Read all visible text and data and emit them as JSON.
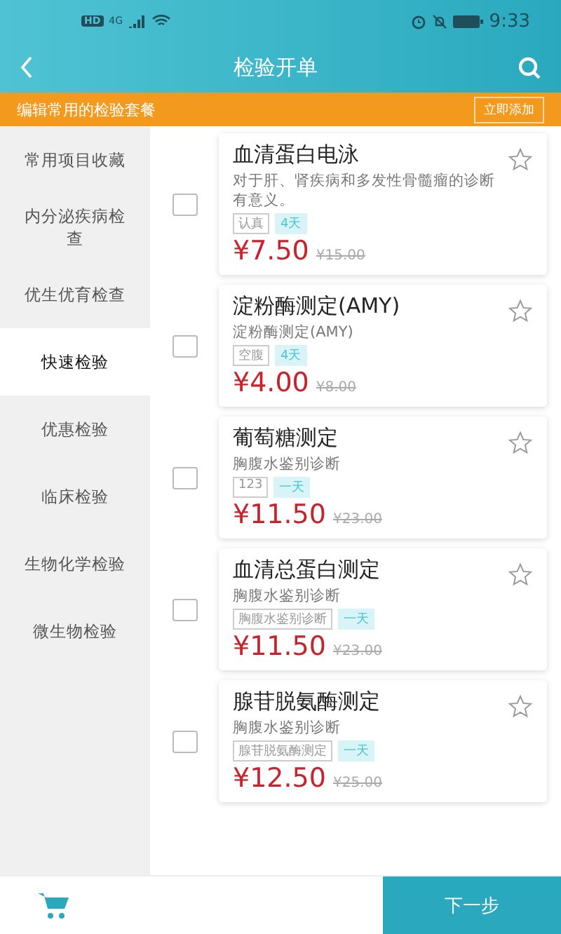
{
  "status_bar": {
    "network_badge": "HD",
    "network_type": "4G",
    "time": "9:33"
  },
  "header": {
    "title": "检验开单"
  },
  "banner": {
    "text": "编辑常用的检验套餐",
    "button": "立即添加"
  },
  "sidebar": {
    "items": [
      {
        "label": "常用项目收藏",
        "selected": false
      },
      {
        "label": "内分泌疾病检查",
        "selected": false
      },
      {
        "label": "优生优育检查",
        "selected": false
      },
      {
        "label": "快速检验",
        "selected": true
      },
      {
        "label": "优惠检验",
        "selected": false
      },
      {
        "label": "临床检验",
        "selected": false
      },
      {
        "label": "生物化学检验",
        "selected": false
      },
      {
        "label": "微生物检验",
        "selected": false
      }
    ]
  },
  "items": [
    {
      "checked": false,
      "name": "血清蛋白电泳",
      "description": "对于肝、肾疾病和多发性骨髓瘤的诊断有意义。",
      "tags": [
        "认真",
        "4天"
      ],
      "price": "¥7.50",
      "original_price": "¥15.00",
      "favorite": false
    },
    {
      "checked": false,
      "name": "淀粉酶测定(AMY)",
      "description": "淀粉酶测定(AMY)",
      "tags": [
        "空腹",
        "4天"
      ],
      "price": "¥4.00",
      "original_price": "¥8.00",
      "favorite": false
    },
    {
      "checked": false,
      "name": "葡萄糖测定",
      "description": "胸腹水鉴别诊断",
      "tags": [
        "123",
        "一天"
      ],
      "price": "¥11.50",
      "original_price": "¥23.00",
      "favorite": false
    },
    {
      "checked": false,
      "name": "血清总蛋白测定",
      "description": "胸腹水鉴别诊断",
      "tags": [
        "胸腹水鉴别诊断",
        "一天"
      ],
      "price": "¥11.50",
      "original_price": "¥23.00",
      "favorite": false
    },
    {
      "checked": false,
      "name": "腺苷脱氨酶测定",
      "description": "胸腹水鉴别诊断",
      "tags": [
        "腺苷脱氨酶测定",
        "一天"
      ],
      "price": "¥12.50",
      "original_price": "¥25.00",
      "favorite": false
    }
  ],
  "footer": {
    "next_button": "下一步"
  }
}
